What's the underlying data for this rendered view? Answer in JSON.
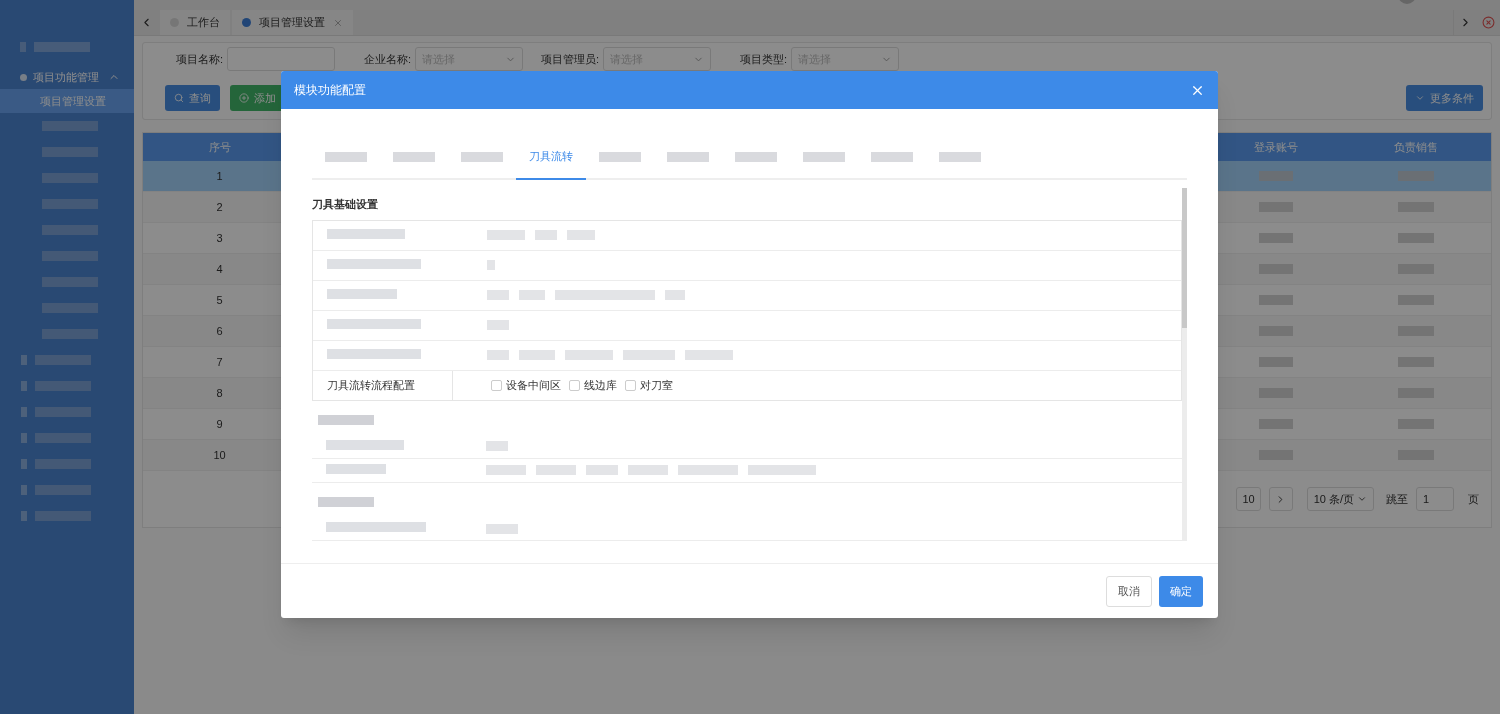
{
  "sidebar": {
    "items": [
      {
        "label": "项目功能管理",
        "expanded": true,
        "children": [
          {
            "label": "项目管理设置",
            "selected": true
          }
        ]
      }
    ]
  },
  "page_tabs": [
    {
      "label": "工作台",
      "selected": false,
      "closable": false
    },
    {
      "label": "项目管理设置",
      "selected": true,
      "closable": true
    }
  ],
  "filters": [
    {
      "label": "项目名称:",
      "kind": "input"
    },
    {
      "label": "企业名称:",
      "kind": "select",
      "placeholder": "请选择"
    },
    {
      "label": "项目管理员:",
      "kind": "select",
      "placeholder": "请选择"
    },
    {
      "label": "项目类型:",
      "kind": "select",
      "placeholder": "请选择"
    }
  ],
  "actions": [
    {
      "label": "查询",
      "kind": "search"
    },
    {
      "label": "添加",
      "kind": "add"
    }
  ],
  "more_button": "更多条件",
  "table": {
    "columns": [
      "序号",
      "登录账号",
      "负责销售"
    ],
    "rows": [
      {
        "index": "1",
        "selected": true
      },
      {
        "index": "2",
        "selected": false
      },
      {
        "index": "3",
        "selected": false
      },
      {
        "index": "4",
        "selected": false
      },
      {
        "index": "5",
        "selected": false
      },
      {
        "index": "6",
        "selected": false
      },
      {
        "index": "7",
        "selected": false
      },
      {
        "index": "8",
        "selected": false
      },
      {
        "index": "9",
        "selected": false
      },
      {
        "index": "10",
        "selected": false
      }
    ]
  },
  "pagination": {
    "last_page": "10",
    "page_size": "10 条/页",
    "jump_label": "跳至",
    "jump_value": "1",
    "page_suffix": "页"
  },
  "modal": {
    "title": "模块功能配置",
    "tabs": [
      {
        "kind": "blurred",
        "selected": false
      },
      {
        "kind": "blurred",
        "selected": false
      },
      {
        "kind": "blurred",
        "selected": false
      },
      {
        "kind": "text",
        "label": "刀具流转",
        "selected": true
      },
      {
        "kind": "blurred",
        "selected": false
      },
      {
        "kind": "blurred",
        "selected": false
      },
      {
        "kind": "blurred",
        "selected": false
      },
      {
        "kind": "blurred",
        "selected": false
      },
      {
        "kind": "blurred",
        "selected": false
      },
      {
        "kind": "blurred",
        "selected": false
      }
    ],
    "section_title": "刀具基础设置",
    "flow_row": {
      "label": "刀具流转流程配置",
      "options": [
        {
          "label": "设备中间区",
          "checked": false
        },
        {
          "label": "线边库",
          "checked": false
        },
        {
          "label": "对刀室",
          "checked": false
        }
      ]
    },
    "buttons": [
      {
        "label": "取消",
        "kind": "secondary"
      },
      {
        "label": "确定",
        "kind": "primary"
      }
    ]
  }
}
